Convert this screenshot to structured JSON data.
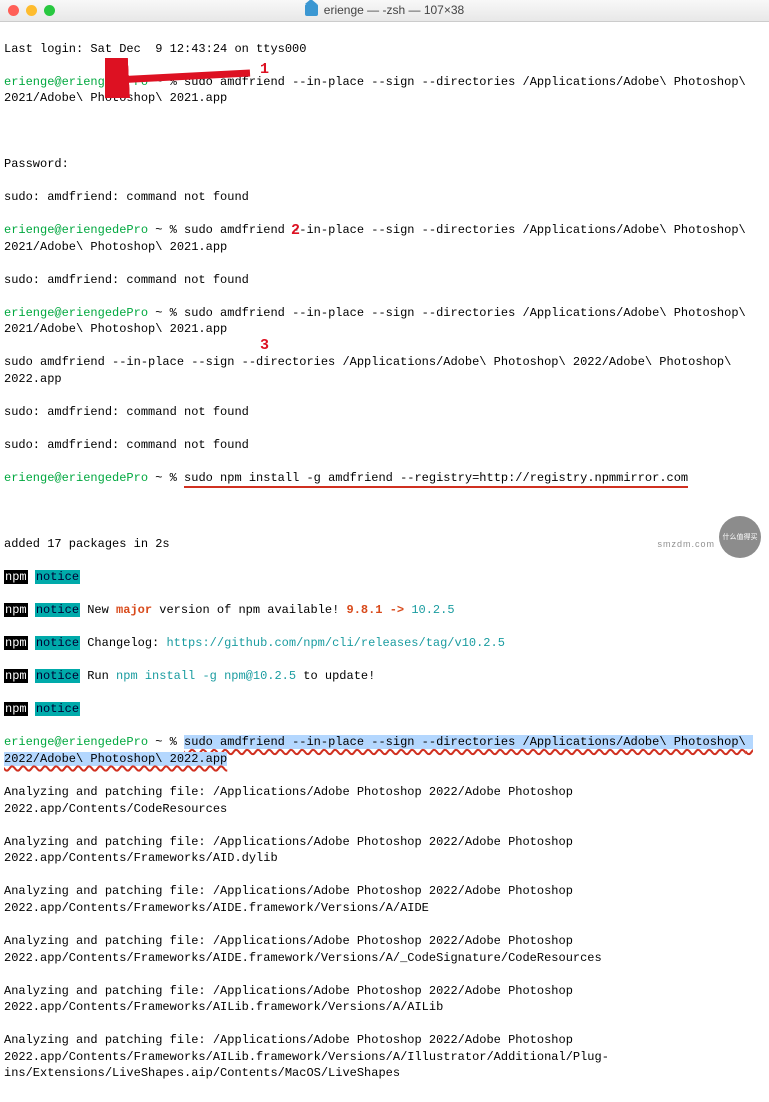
{
  "window": {
    "title": "erienge — -zsh — 107×38"
  },
  "annotations": {
    "m1": "1",
    "m2": "2",
    "m3": "3"
  },
  "prompt": {
    "userhost": "erienge@eriengedePro",
    "path": "~",
    "sigil": "%"
  },
  "cmd": {
    "c1": "sudo amdfriend --in-place --sign --directories /Applications/Adobe\\ Photoshop\\ 2021/Adobe\\ Photoshop\\ 2021.app",
    "c2": "sudo amdfriend --in-place --sign --directories /Applications/Adobe\\ Photoshop\\ 2021/Adobe\\ Photoshop\\ 2021.app",
    "c3": "sudo amdfriend --in-place --sign --directories /Applications/Adobe\\ Photoshop\\ 2021/Adobe\\ Photoshop\\ 2021.app",
    "c3b": "sudo amdfriend --in-place --sign --directories /Applications/Adobe\\ Photoshop\\ 2022/Adobe\\ Photoshop\\ 2022.app",
    "c4": "sudo npm install -g amdfriend --registry=http://registry.npmmirror.com",
    "c5": "sudo amdfriend --in-place --sign --directories /Applications/Adobe\\ Photoshop\\ 2022/Adobe\\ Photoshop\\ 2022.app"
  },
  "out": {
    "lastlogin": "Last login: Sat Dec  9 12:43:24 on ttys000",
    "password": "Password:",
    "notfound": "sudo: amdfriend: command not found",
    "added": "added 17 packages in 2s",
    "npm_major_a": "New ",
    "npm_major_b": "major",
    "npm_major_c": " version of npm available! ",
    "npm_major_d": "9.8.1 -> ",
    "npm_major_e": "10.2.5",
    "changelog_a": "Changelog: ",
    "changelog_b": "https://github.com/npm/cli/releases/tag/v10.2.5",
    "run_a": "Run ",
    "run_b": "npm install -g npm@10.2.5",
    "run_c": " to update!",
    "ap0": "Analyzing and patching file: /Applications/Adobe Photoshop 2022/Adobe Photoshop 2022.app/Contents/CodeResources",
    "ap1": "Analyzing and patching file: /Applications/Adobe Photoshop 2022/Adobe Photoshop 2022.app/Contents/Frameworks/AID.dylib",
    "ap2": "Analyzing and patching file: /Applications/Adobe Photoshop 2022/Adobe Photoshop 2022.app/Contents/Frameworks/AIDE.framework/Versions/A/AIDE",
    "ap3": "Analyzing and patching file: /Applications/Adobe Photoshop 2022/Adobe Photoshop 2022.app/Contents/Frameworks/AIDE.framework/Versions/A/_CodeSignature/CodeResources",
    "ap4": "Analyzing and patching file: /Applications/Adobe Photoshop 2022/Adobe Photoshop 2022.app/Contents/Frameworks/AILib.framework/Versions/A/AILib",
    "ap5": "Analyzing and patching file: /Applications/Adobe Photoshop 2022/Adobe Photoshop 2022.app/Contents/Frameworks/AILib.framework/Versions/A/Illustrator/Additional/Plug-ins/Extensions/LiveShapes.aip/Contents/MacOS/LiveShapes"
  },
  "npmtag": {
    "npm": "npm",
    "notice": "notice"
  },
  "watermark": {
    "brand": "什么值得买",
    "site": "smzdm.com"
  }
}
